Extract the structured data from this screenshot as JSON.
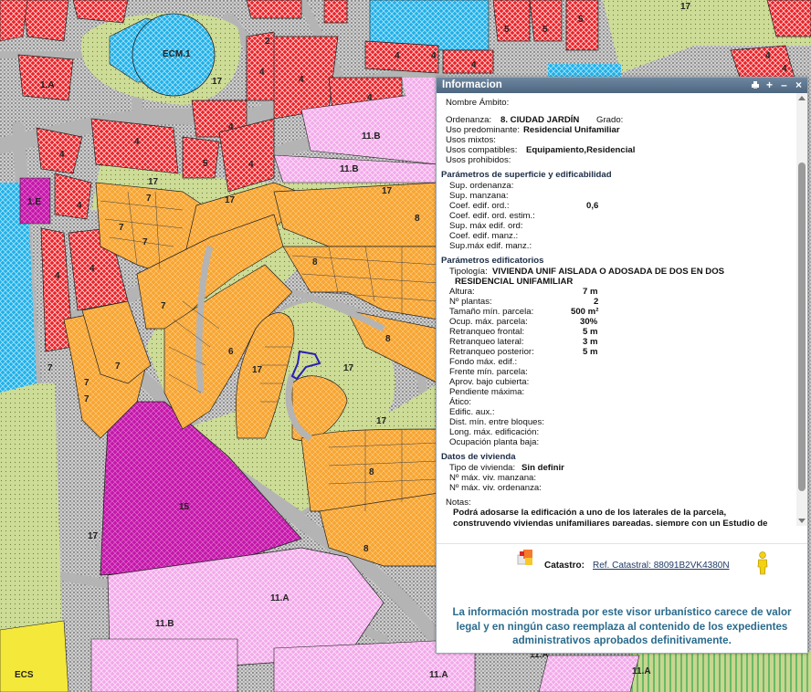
{
  "map_labels": [
    "ECM.1",
    "2",
    "5",
    "5",
    "5",
    "17",
    "1.A",
    "17",
    "4",
    "4",
    "4",
    "4",
    "4",
    "4",
    "4",
    "4",
    "5",
    "4",
    "4",
    "4",
    "4",
    "11.B",
    "11.B",
    "1.E",
    "4",
    "4",
    "4",
    "17",
    "7",
    "7",
    "7",
    "7",
    "7",
    "7",
    "17",
    "8",
    "8",
    "17",
    "6",
    "17",
    "8",
    "17",
    "17",
    "7",
    "7",
    "8",
    "8",
    "15",
    "17",
    "11.A",
    "11.B",
    "ECS",
    "11.A",
    "11.A",
    "11.A"
  ],
  "panel": {
    "title": "Informacion",
    "nombre_ambito_label": "Nombre Ámbito:",
    "ordenanza_label": "Ordenanza:",
    "ordenanza_value": "8. CIUDAD JARDÍN",
    "grado_label": "Grado:",
    "uso_predominante_label": "Uso predominante:",
    "uso_predominante_value": "Residencial Unifamiliar",
    "usos_mixtos_label": "Usos mixtos:",
    "usos_compatibles_label": "Usos compatibles:",
    "usos_compatibles_value": "Equipamiento,Residencial",
    "usos_prohibidos_label": "Usos prohibidos:",
    "sec_superficie": "Parámetros de superficie y edificabilidad",
    "superficie": [
      {
        "label": "Sup. ordenanza:",
        "value": ""
      },
      {
        "label": "Sup. manzana:",
        "value": ""
      },
      {
        "label": "Coef. edif. ord.:",
        "value": "0,6"
      },
      {
        "label": "Coef. edif. ord. estim.:",
        "value": ""
      },
      {
        "label": "Sup. máx edif. ord:",
        "value": ""
      },
      {
        "label": "Coef. edif. manz.:",
        "value": ""
      },
      {
        "label": "Sup.máx edif. manz.:",
        "value": ""
      }
    ],
    "sec_edificatorios": "Parámetros edificatorios",
    "tipologia_label": "Tipología:",
    "tipologia_value_1": "VIVIENDA UNIF AISLADA O ADOSADA DE DOS EN DOS",
    "tipologia_value_2": "RESIDENCIAL UNIFAMILIAR",
    "edificatorios": [
      {
        "label": "Altura:",
        "value": "7 m"
      },
      {
        "label": "Nº plantas:",
        "value": "2"
      },
      {
        "label": "Tamaño mín. parcela:",
        "value": "500 m²"
      },
      {
        "label": "Ocup. máx. parcela:",
        "value": "30%"
      },
      {
        "label": "Retranqueo frontal:",
        "value": "5 m"
      },
      {
        "label": "Retranqueo lateral:",
        "value": "3 m"
      },
      {
        "label": "Retranqueo posterior:",
        "value": "5 m"
      },
      {
        "label": "Fondo máx. edif.:",
        "value": ""
      },
      {
        "label": "Frente mín. parcela:",
        "value": ""
      },
      {
        "label": "Aprov. bajo cubierta:",
        "value": ""
      },
      {
        "label": "Pendiente máxima:",
        "value": ""
      },
      {
        "label": "Ático:",
        "value": ""
      },
      {
        "label": "Edific. aux.:",
        "value": ""
      },
      {
        "label": "Dist. mín. entre bloques:",
        "value": ""
      },
      {
        "label": "Long. máx. edificación:",
        "value": ""
      },
      {
        "label": "Ocupación planta baja:",
        "value": ""
      }
    ],
    "sec_vivienda": "Datos de vivienda",
    "tipo_vivienda_label": "Tipo de vivienda:",
    "tipo_vivienda_value": "Sin definir",
    "viv_manzana_label": "Nº máx. viv. manzana:",
    "viv_ordenanza_label": "Nº máx. viv. ordenanza:",
    "notas_label": "Notas:",
    "notas_value": "Podrá adosarse la edificación a uno de los laterales de la parcela, construyendo viviendas unifamiliares pareadas, siempre con un Estudio de Detalle que determine los linderos de adosamiento",
    "catastro_label": "Catastro:",
    "catastro_link": "Ref. Catastral: 88091B2VK4380N",
    "disclaimer": "La información mostrada por este visor urbanístico carece de valor legal y en ningún caso reemplaza al contenido de los expedientes administrativos aprobados definitivamente."
  },
  "colors": {
    "title_bar": "#587089",
    "section": "#1b2c46",
    "disclaimer": "#2b6b8c",
    "link": "#203a66",
    "red_zone": "#e8242a",
    "orange_zone": "#f7a635",
    "pink_zone": "#f0a8e8",
    "magenta_zone": "#c218a8",
    "green_zone": "#c6d98a",
    "road": "#b4b4b4"
  },
  "icons": [
    "print-icon",
    "add-icon",
    "minimize-icon",
    "close-icon",
    "catastro-icon",
    "street-view-person-icon"
  ]
}
